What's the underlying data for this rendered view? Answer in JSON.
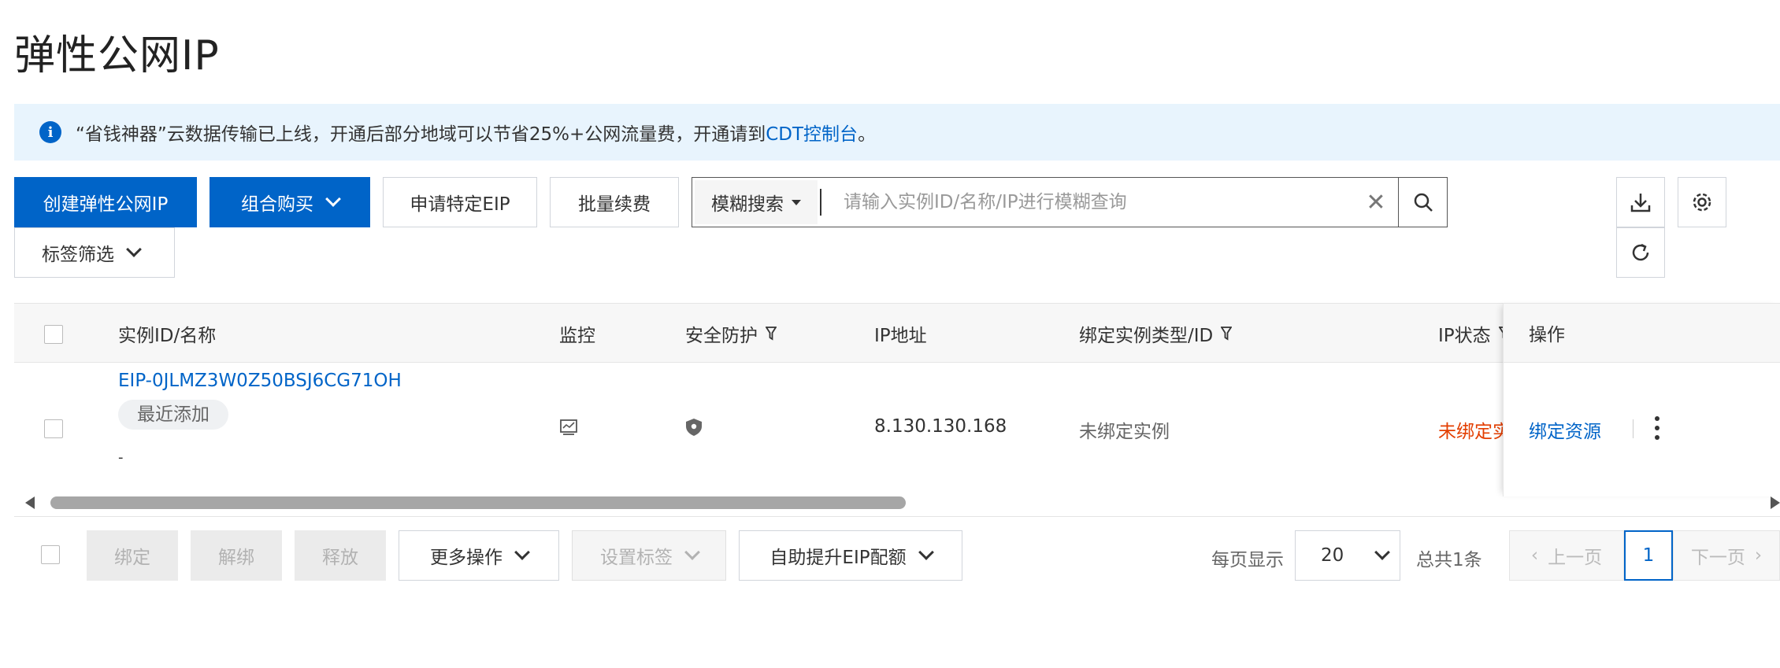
{
  "page": {
    "title": "弹性公网IP"
  },
  "notice": {
    "text": "“省钱神器”云数据传输已上线，开通后部分地域可以节省25%+公网流量费，开通请到",
    "link": "CDT控制台",
    "suffix": "。"
  },
  "toolbar": {
    "create": "创建弹性公网IP",
    "combo_buy": "组合购买",
    "apply_specific": "申请特定EIP",
    "batch_renew": "批量续费",
    "search_type": "模糊搜索",
    "search_placeholder": "请输入实例ID/名称/IP进行模糊查询",
    "tag_filter": "标签筛选"
  },
  "table": {
    "columns": {
      "instance": "实例ID/名称",
      "monitor": "监控",
      "protection": "安全防护",
      "ip": "IP地址",
      "bound": "绑定实例类型/ID",
      "status": "IP状态",
      "ops": "操作"
    },
    "rows": [
      {
        "id": "EIP-0JLMZ3W0Z50BSJ6CG71OH",
        "tag": "最近添加",
        "name": "-",
        "ip": "8.130.130.168",
        "bound": "未绑定实例",
        "status": "未绑定实",
        "op": "绑定资源"
      }
    ]
  },
  "footer": {
    "bind": "绑定",
    "unbind": "解绑",
    "release": "释放",
    "more_ops": "更多操作",
    "set_tags": "设置标签",
    "raise_quota": "自助提升EIP配额",
    "per_page_label": "每页显示",
    "per_page": "20",
    "total": "总共1条",
    "prev": "上一页",
    "current_page": "1",
    "next": "下一页"
  },
  "colors": {
    "primary": "#0064c8",
    "danger": "#e33e00",
    "notice_bg": "#e8f4fd"
  }
}
